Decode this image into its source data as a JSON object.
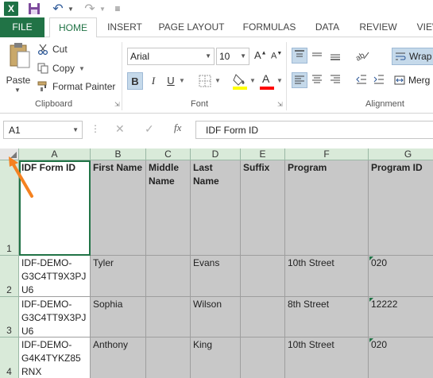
{
  "app": {
    "logo_letter": "X"
  },
  "ribbon_tabs": [
    "FILE",
    "HOME",
    "INSERT",
    "PAGE LAYOUT",
    "FORMULAS",
    "DATA",
    "REVIEW",
    "VIEW"
  ],
  "clipboard": {
    "paste_label": "Paste",
    "cut_label": "Cut",
    "copy_label": "Copy",
    "format_painter_label": "Format Painter",
    "group_label": "Clipboard"
  },
  "font": {
    "name": "Arial",
    "size": "10",
    "bold": "B",
    "italic": "I",
    "underline": "U",
    "grow": "A",
    "shrink": "A",
    "color_letter": "A",
    "group_label": "Font",
    "fill_color": "#ffff00",
    "text_color": "#ff0000"
  },
  "alignment": {
    "wrap_label": "Wrap",
    "merge_label": "Merg",
    "group_label": "Alignment"
  },
  "formula_bar": {
    "name_box": "A1",
    "fx": "fx",
    "value": "IDF Form ID"
  },
  "grid": {
    "columns": [
      "A",
      "B",
      "C",
      "D",
      "E",
      "F",
      "G"
    ],
    "rows": [
      "1",
      "2",
      "3",
      "4"
    ],
    "header_row": [
      "IDF Form ID",
      "First Name",
      "Middle Name",
      "Last Name",
      "Suffix",
      "Program",
      "Program ID"
    ],
    "data_rows": [
      [
        "IDF-DEMO-G3C4TT9X3PJU6",
        "Tyler",
        "",
        "Evans",
        "",
        "10th Street",
        "020"
      ],
      [
        "IDF-DEMO-G3C4TT9X3PJU6",
        "Sophia",
        "",
        "Wilson",
        "",
        "8th Street",
        "12222"
      ],
      [
        "IDF-DEMO-G4K4TYKZ85RNX",
        "Anthony",
        "",
        "King",
        "",
        "10th Street",
        "020"
      ]
    ]
  },
  "colors": {
    "accent": "#217346",
    "annotation_arrow": "#f58220",
    "cell_fill": "#c8c8c8"
  }
}
